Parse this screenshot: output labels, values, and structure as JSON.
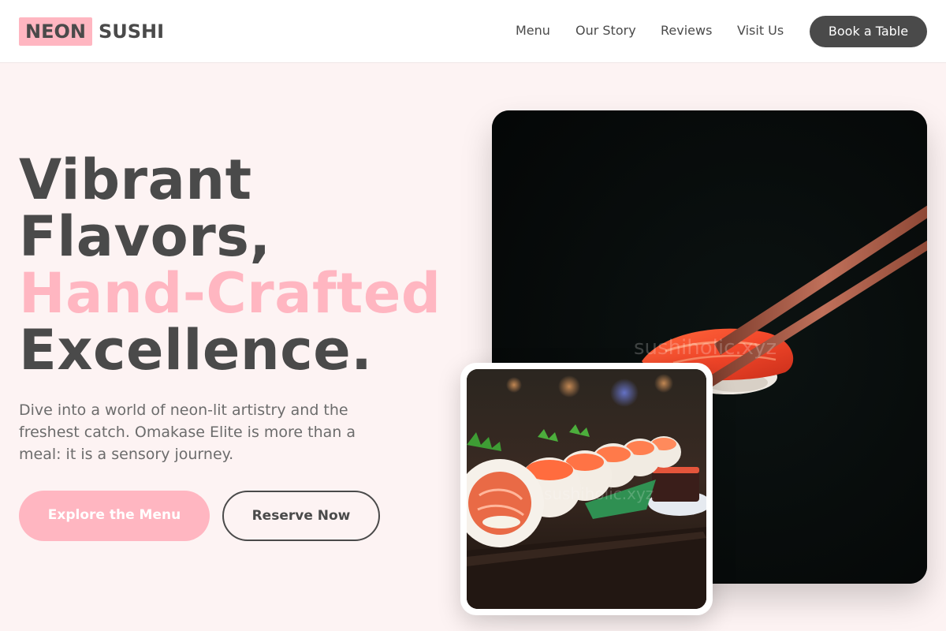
{
  "brand": {
    "highlight": "NEON",
    "rest": "SUSHI"
  },
  "nav": {
    "links": [
      "Menu",
      "Our Story",
      "Reviews",
      "Visit Us"
    ],
    "cta": "Book a Table"
  },
  "hero": {
    "headline": {
      "line1": "Vibrant",
      "line2": "Flavors,",
      "line3_accent": "Hand-Crafted",
      "line4": "Excellence."
    },
    "lede": "Dive into a world of neon-lit artistry and the freshest catch. Omakase Elite is more than a meal: it is a sensory journey.",
    "primary_button": "Explore the Menu",
    "secondary_button": "Reserve Now"
  },
  "images": {
    "main_watermark": "sushiholic.xyz",
    "inset_watermark": "sushiholic.xyz"
  },
  "colors": {
    "accent_pink": "#ffb6c1",
    "dark_gray": "#4a4a4a",
    "page_bg": "#fdf3f3"
  }
}
